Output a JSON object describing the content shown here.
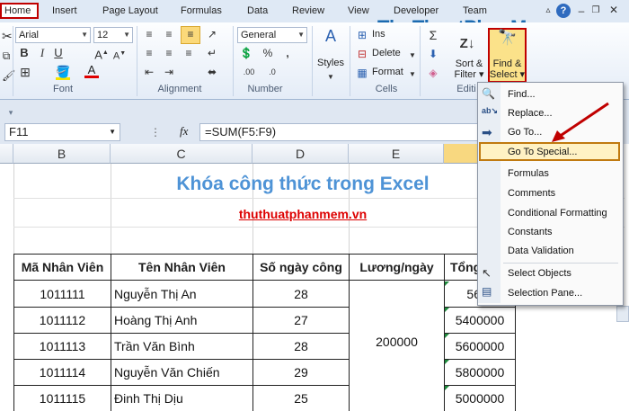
{
  "tabs": [
    "Home",
    "Insert",
    "Page Layout",
    "Formulas",
    "Data",
    "Review",
    "View",
    "Developer",
    "Team"
  ],
  "watermark": "ThuThuatPhanMem.vn",
  "font": {
    "name": "Arial",
    "size": "12"
  },
  "number_format": "General",
  "group_labels": {
    "font": "Font",
    "alignment": "Alignment",
    "number": "Number",
    "cells": "Cells",
    "editing": "Editi"
  },
  "cells_buttons": {
    "insert": "Ins",
    "delete": "Delete",
    "format": "Format"
  },
  "styles_label": "Styles",
  "sort_filter_label": [
    "Sort &",
    "Filter"
  ],
  "find_select_label": [
    "Find &",
    "Select"
  ],
  "name_box": "F11",
  "fx": "fx",
  "formula": "=SUM(F5:F9)",
  "columns": [
    "B",
    "C",
    "D",
    "E"
  ],
  "sheet_title": "Khóa công thức trong Excel",
  "site_link": "thuthuatphanmem.vn",
  "table": {
    "headers": [
      "Mã Nhân Viên",
      "Tên Nhân Viên",
      "Số ngày công",
      "Lương/ngày",
      "Tổng"
    ],
    "rows": [
      {
        "id": "1011111",
        "name": "Nguyễn Thị An",
        "days": "28",
        "total": "56"
      },
      {
        "id": "1011112",
        "name": "Hoàng Thị Anh",
        "days": "27",
        "total": "5400000"
      },
      {
        "id": "1011113",
        "name": "Trần Văn Bình",
        "days": "28",
        "total": "5600000"
      },
      {
        "id": "1011114",
        "name": "Nguyễn Văn Chiến",
        "days": "29",
        "total": "5800000"
      },
      {
        "id": "1011115",
        "name": "Đinh Thị Dịu",
        "days": "25",
        "total": "5000000"
      }
    ],
    "salary": "200000"
  },
  "menu": {
    "items": [
      "Find...",
      "Replace...",
      "Go To...",
      "Go To Special...",
      "Formulas",
      "Comments",
      "Conditional Formatting",
      "Constants",
      "Data Validation",
      "Select Objects",
      "Selection Pane..."
    ],
    "highlighted": "Go To Special..."
  },
  "colors": {
    "accent_red": "#c00000",
    "title_blue": "#4e93d6",
    "link_red": "#dd0000",
    "highlight": "#fff2c4",
    "green_marker": "#1e8a3c"
  }
}
